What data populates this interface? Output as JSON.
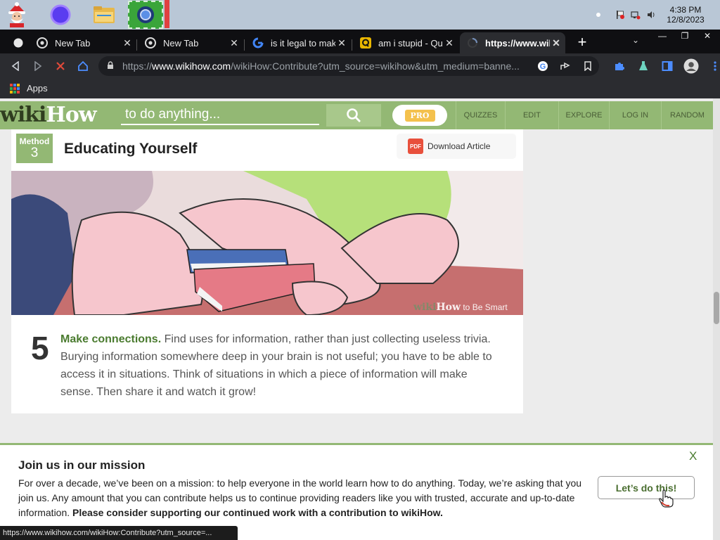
{
  "taskbar": {
    "clock_time": "4:38 PM",
    "clock_date": "12/8/2023",
    "icons": [
      "santa-icon",
      "circle-icon",
      "file-explorer-icon",
      "chrome-icon"
    ]
  },
  "tabs": [
    {
      "title": "New Tab",
      "favicon": "circle-icon"
    },
    {
      "title": "New Tab",
      "favicon": "chrome-icon"
    },
    {
      "title": "New Tab",
      "favicon": "chrome-icon"
    },
    {
      "title": "is it legal to mak",
      "favicon": "google-icon"
    },
    {
      "title": "am i stupid - Qu",
      "favicon": "quora-icon"
    },
    {
      "title": "https://www.wik",
      "favicon": "loading-spinner-icon",
      "active": true
    }
  ],
  "address_bar": {
    "url_prefix": "https://",
    "url_domain": "www.wikihow.com",
    "url_rest": "/wikiHow:Contribute?utm_source=wikihow&utm_medium=banne..."
  },
  "bookmarks": {
    "apps_label": "Apps"
  },
  "site": {
    "logo_wiki": "wiki",
    "logo_how": "How",
    "search_placeholder": "to do anything...",
    "pro_label": "PRO",
    "nav": [
      "QUIZZES",
      "EDIT",
      "EXPLORE",
      "LOG IN",
      "RANDOM"
    ]
  },
  "article": {
    "method_label": "Method",
    "method_number": "3",
    "method_title": "Educating Yourself",
    "download_label": "Download Article",
    "image_watermark_wiki": "wiki",
    "image_watermark_how": "How",
    "image_watermark_rest": " to Be Smart",
    "step_number": "5",
    "step_lead": "Make connections.",
    "step_text": "Find uses for information, rather than just collecting useless trivia. Burying information somewhere deep in your brain is not useful; you have to be able to access it in situations. Think of situations in which a piece of information will make sense. Then share it and watch it grow!"
  },
  "banner": {
    "title": "Join us in our mission",
    "body": "For over a decade, we’ve been on a mission: to help everyone in the world learn how to do anything. Today, we’re asking that you join us. Any amount that you can contribute helps us to continue providing readers like you with trusted, accurate and up-to-date information.",
    "body_bold": "Please consider supporting our continued work with a contribution to wikiHow.",
    "close_label": "X",
    "button_label": "Let’s do this!"
  },
  "status_url": "https://www.wikihow.com/wikiHow:Contribute?utm_source=...",
  "colors": {
    "wikihow_green": "#93b874",
    "link_green": "#4a7b2f",
    "chrome_dark": "#2b2c30"
  }
}
